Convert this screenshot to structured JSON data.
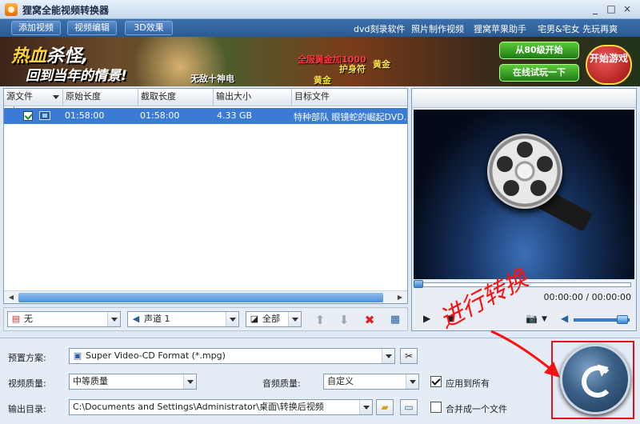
{
  "window": {
    "title": "狸窝全能视频转换器",
    "minimize": "_",
    "maximize": "□",
    "close": "×"
  },
  "toolbar": {
    "buttons": [
      "添加视频",
      "视频编辑",
      "3D效果"
    ],
    "links": [
      "dvd刻录软件",
      "照片制作视频",
      "狸窝苹果助手",
      "宅男&宅女 先玩再爽"
    ]
  },
  "banner": {
    "title_hot": "热血",
    "title_rest": "杀怪,",
    "subtitle": "回到当年的情景!",
    "labels": [
      "无敌十神电",
      "全服黄金加1000",
      "护身符",
      "黄金",
      "黄金"
    ],
    "btn_level": "从80级开始",
    "btn_try": "在线试玩一下",
    "btn_start": "开始游戏"
  },
  "file_list": {
    "columns": [
      "源文件",
      "原始长度",
      "截取长度",
      "输出大小",
      "目标文件"
    ],
    "rows": [
      {
        "checked": true,
        "original_length": "01:58:00",
        "cut_length": "01:58:00",
        "output_size": "4.33 GB",
        "target_file": "特种部队 眼镜蛇的崛起DVD."
      }
    ]
  },
  "controls": {
    "subtitle_value": "无",
    "audio_track_value": "声道 1",
    "crop_value": "全部"
  },
  "preview": {
    "time": "00:00:00 / 00:00:00",
    "volume_level": 0.8
  },
  "settings": {
    "preset_label": "预置方案:",
    "preset_value": "Super Video-CD Format (*.mpg)",
    "video_quality_label": "视频质量:",
    "video_quality_value": "中等质量",
    "audio_quality_label": "音频质量:",
    "audio_quality_value": "自定义",
    "apply_all_label": "应用到所有",
    "apply_all_checked": true,
    "output_dir_label": "输出目录:",
    "output_dir_value": "C:\\Documents and Settings\\Administrator\\桌面\\转换后视频",
    "merge_label": "合并成一个文件",
    "merge_checked": false
  },
  "annotation": {
    "text": "进行转换",
    "color": "#ff1010"
  },
  "colors": {
    "selection": "#3b7bd6",
    "accent": "#2a5f9e",
    "highlight_frame": "#e0151b"
  }
}
